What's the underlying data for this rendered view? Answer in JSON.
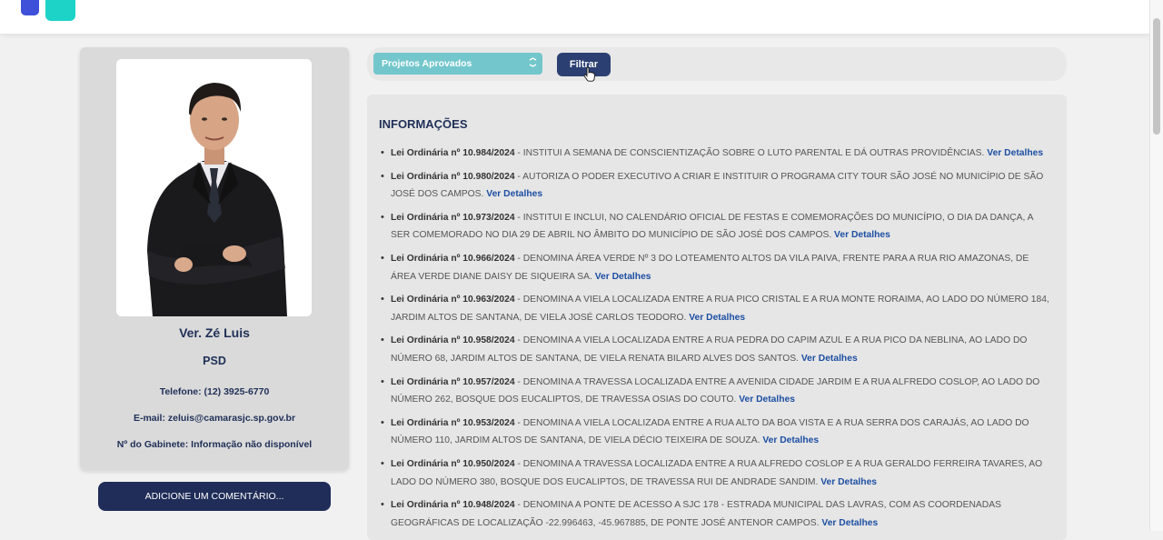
{
  "profile": {
    "name": "Ver. Zé Luis",
    "party": "PSD",
    "phone": "Telefone: (12) 3925-6770",
    "email": "E-mail: zeluis@camarasjc.sp.gov.br",
    "office": "Nº do Gabinete: Informação não disponível",
    "comment_button": "ADICIONE UM COMENTÁRIO..."
  },
  "filter": {
    "selected": "Projetos Aprovados",
    "button": "Filtrar"
  },
  "info": {
    "title": "INFORMAÇÕES",
    "link_label": "Ver Detalhes",
    "laws": [
      {
        "id": "Lei Ordinária nº 10.984/2024",
        "text": " - INSTITUI A SEMANA DE CONSCIENTIZAÇÃO SOBRE O LUTO PARENTAL E DÁ OUTRAS PROVIDÊNCIAS. "
      },
      {
        "id": "Lei Ordinária nº 10.980/2024",
        "text": " - AUTORIZA O PODER EXECUTIVO A CRIAR E INSTITUIR O PROGRAMA CITY TOUR SÃO JOSÉ NO MUNICÍPIO DE SÃO JOSÉ DOS CAMPOS. "
      },
      {
        "id": "Lei Ordinária nº 10.973/2024",
        "text": " - INSTITUI E INCLUI, NO CALENDÁRIO OFICIAL DE FESTAS E COMEMORAÇÕES DO MUNICÍPIO, O DIA DA DANÇA, A SER COMEMORADO NO DIA 29 DE ABRIL NO ÂMBITO DO MUNICÍPIO DE SÃO JOSÉ DOS CAMPOS. "
      },
      {
        "id": "Lei Ordinária nº 10.966/2024",
        "text": " - DENOMINA ÁREA VERDE Nº 3 DO LOTEAMENTO ALTOS DA VILA PAIVA, FRENTE PARA A RUA RIO AMAZONAS, DE ÁREA VERDE DIANE DAISY DE SIQUEIRA SA. "
      },
      {
        "id": "Lei Ordinária nº 10.963/2024",
        "text": " - DENOMINA A VIELA LOCALIZADA ENTRE A RUA PICO CRISTAL E A RUA MONTE RORAIMA, AO LADO DO NÚMERO 184, JARDIM ALTOS DE SANTANA, DE VIELA JOSÉ CARLOS TEODORO. "
      },
      {
        "id": "Lei Ordinária nº 10.958/2024",
        "text": " - DENOMINA A VIELA LOCALIZADA ENTRE A RUA PEDRA DO CAPIM AZUL E A RUA PICO DA NEBLINA, AO LADO DO NÚMERO 68, JARDIM ALTOS DE SANTANA, DE VIELA RENATA BILARD ALVES DOS SANTOS. "
      },
      {
        "id": "Lei Ordinária nº 10.957/2024",
        "text": " - DENOMINA A TRAVESSA LOCALIZADA ENTRE A AVENIDA CIDADE JARDIM E A RUA ALFREDO COSLOP, AO LADO DO NÚMERO 262, BOSQUE DOS EUCALIPTOS, DE TRAVESSA OSIAS DO COUTO. "
      },
      {
        "id": "Lei Ordinária nº 10.953/2024",
        "text": " - DENOMINA A VIELA LOCALIZADA ENTRE A RUA ALTO DA BOA VISTA E A RUA SERRA DOS CARAJÁS, AO LADO DO NÚMERO 110, JARDIM ALTOS DE SANTANA, DE VIELA DÉCIO TEIXEIRA DE SOUZA. "
      },
      {
        "id": "Lei Ordinária nº 10.950/2024",
        "text": " - DENOMINA A TRAVESSA LOCALIZADA ENTRE A RUA ALFREDO COSLOP E A RUA GERALDO FERREIRA TAVARES, AO LADO DO NÚMERO 380, BOSQUE DOS EUCALIPTOS, DE TRAVESSA RUI DE ANDRADE SANDIM. "
      },
      {
        "id": "Lei Ordinária nº 10.948/2024",
        "text": " - DENOMINA A PONTE DE ACESSO A SJC 178 - ESTRADA MUNICIPAL DAS LAVRAS, COM AS COORDENADAS GEOGRÁFICAS DE LOCALIZAÇÃO -22.996463, -45.967885, DE PONTE JOSÉ ANTENOR CAMPOS. "
      }
    ]
  }
}
